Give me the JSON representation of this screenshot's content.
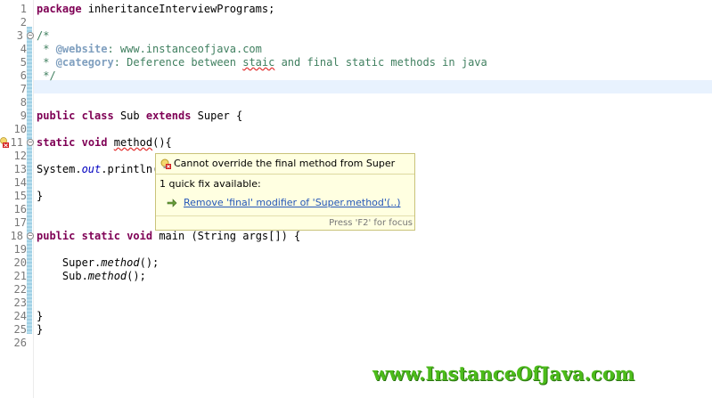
{
  "editor": {
    "lines": [
      {
        "n": "1",
        "fold": false,
        "error": false,
        "segments": [
          {
            "t": "package",
            "c": "kw"
          },
          {
            "t": " inheritanceInterviewPrograms;",
            "c": ""
          }
        ]
      },
      {
        "n": "2",
        "fold": false,
        "error": false,
        "segments": []
      },
      {
        "n": "3",
        "fold": true,
        "error": false,
        "segments": [
          {
            "t": "/*",
            "c": "cm"
          }
        ]
      },
      {
        "n": "4",
        "fold": false,
        "error": false,
        "segments": [
          {
            "t": " * ",
            "c": "cm"
          },
          {
            "t": "@website",
            "c": "tag"
          },
          {
            "t": ": www.instanceofjava.com",
            "c": "cm"
          }
        ]
      },
      {
        "n": "5",
        "fold": false,
        "error": false,
        "segments": [
          {
            "t": " * ",
            "c": "cm"
          },
          {
            "t": "@category",
            "c": "tag"
          },
          {
            "t": ": Deference between ",
            "c": "cm"
          },
          {
            "t": "staic",
            "c": "cm squiggle"
          },
          {
            "t": " and final static methods in java",
            "c": "cm"
          }
        ]
      },
      {
        "n": "6",
        "fold": false,
        "error": false,
        "segments": [
          {
            "t": " */",
            "c": "cm"
          }
        ]
      },
      {
        "n": "7",
        "fold": false,
        "error": false,
        "segments": []
      },
      {
        "n": "8",
        "fold": false,
        "error": false,
        "segments": []
      },
      {
        "n": "9",
        "fold": false,
        "error": false,
        "segments": [
          {
            "t": "public",
            "c": "kw"
          },
          {
            "t": " ",
            "c": ""
          },
          {
            "t": "class",
            "c": "kw"
          },
          {
            "t": " Sub ",
            "c": ""
          },
          {
            "t": "extends",
            "c": "kw"
          },
          {
            "t": " Super {",
            "c": ""
          }
        ]
      },
      {
        "n": "10",
        "fold": false,
        "error": false,
        "segments": []
      },
      {
        "n": "11",
        "fold": true,
        "error": true,
        "segments": [
          {
            "t": "static",
            "c": "kw"
          },
          {
            "t": " ",
            "c": ""
          },
          {
            "t": "void",
            "c": "kw"
          },
          {
            "t": " ",
            "c": ""
          },
          {
            "t": "method",
            "c": "squiggle"
          },
          {
            "t": "(){",
            "c": ""
          }
        ]
      },
      {
        "n": "12",
        "fold": false,
        "error": false,
        "segments": []
      },
      {
        "n": "13",
        "fold": false,
        "error": false,
        "segments": [
          {
            "t": "System.",
            "c": ""
          },
          {
            "t": "out",
            "c": "fld"
          },
          {
            "t": ".println(",
            "c": ""
          }
        ]
      },
      {
        "n": "14",
        "fold": false,
        "error": false,
        "segments": []
      },
      {
        "n": "15",
        "fold": false,
        "error": false,
        "segments": [
          {
            "t": "}",
            "c": ""
          }
        ]
      },
      {
        "n": "16",
        "fold": false,
        "error": false,
        "segments": []
      },
      {
        "n": "17",
        "fold": false,
        "error": false,
        "segments": []
      },
      {
        "n": "18",
        "fold": true,
        "error": false,
        "segments": [
          {
            "t": "public",
            "c": "kw"
          },
          {
            "t": " ",
            "c": ""
          },
          {
            "t": "static",
            "c": "kw"
          },
          {
            "t": " ",
            "c": ""
          },
          {
            "t": "void",
            "c": "kw"
          },
          {
            "t": " main (String args[]) {",
            "c": ""
          }
        ]
      },
      {
        "n": "19",
        "fold": false,
        "error": false,
        "segments": []
      },
      {
        "n": "20",
        "fold": false,
        "error": false,
        "segments": [
          {
            "t": "    Super.",
            "c": ""
          },
          {
            "t": "method",
            "c": "it"
          },
          {
            "t": "();",
            "c": ""
          }
        ]
      },
      {
        "n": "21",
        "fold": false,
        "error": false,
        "segments": [
          {
            "t": "    Sub.",
            "c": ""
          },
          {
            "t": "method",
            "c": "it"
          },
          {
            "t": "();",
            "c": ""
          }
        ]
      },
      {
        "n": "22",
        "fold": false,
        "error": false,
        "segments": []
      },
      {
        "n": "23",
        "fold": false,
        "error": false,
        "segments": []
      },
      {
        "n": "24",
        "fold": false,
        "error": false,
        "segments": [
          {
            "t": "}",
            "c": ""
          }
        ]
      },
      {
        "n": "25",
        "fold": false,
        "error": false,
        "segments": [
          {
            "t": "}",
            "c": ""
          }
        ]
      },
      {
        "n": "26",
        "fold": false,
        "error": false,
        "segments": []
      }
    ]
  },
  "tooltip": {
    "title": "Cannot override the final method from Super",
    "quickfix_count": "1 quick fix available:",
    "fix_label": "Remove 'final' modifier of 'Super.method'(..)",
    "focus_hint": "Press 'F2' for focus"
  },
  "watermark": "www.InstanceOfJava.com",
  "colors": {
    "keyword": "#7f0055",
    "comment": "#3f7f5f",
    "javadoc_tag": "#7f9fbf",
    "error": "#e23232",
    "tooltip_bg": "#ffffe1",
    "watermark": "#4cbc1a"
  },
  "icons": {
    "error_marker": "error-lightbulb-icon",
    "fix": "quick-fix-arrow-icon"
  }
}
